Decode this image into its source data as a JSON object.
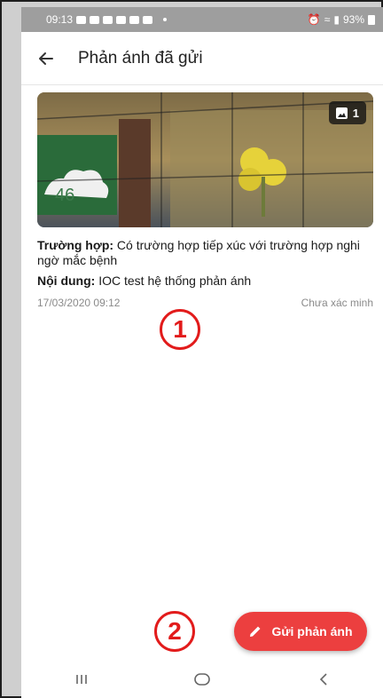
{
  "status_bar": {
    "time": "09:13",
    "battery": "93%"
  },
  "app_bar": {
    "back_icon": "arrow-left-icon",
    "title": "Phản ánh đã gửi"
  },
  "report_card": {
    "image_count": "1",
    "image_icon": "image-icon",
    "case_label": "Trường hợp:",
    "case_value": "Có trường hợp tiếp xúc với trường hợp nghi ngờ mắc bệnh",
    "content_label": "Nội dung:",
    "content_value": "IOC test hệ thống phản ánh",
    "timestamp": "17/03/2020 09:12",
    "status": "Chưa xác minh"
  },
  "annotations": {
    "marker_1": "1",
    "marker_2": "2"
  },
  "fab": {
    "icon": "pencil-icon",
    "label": "Gửi phản ánh",
    "color": "#ec3f3f"
  },
  "nav_bar": {
    "recents_icon": "recents-icon",
    "home_icon": "home-icon",
    "back_icon": "back-chevron-icon"
  }
}
